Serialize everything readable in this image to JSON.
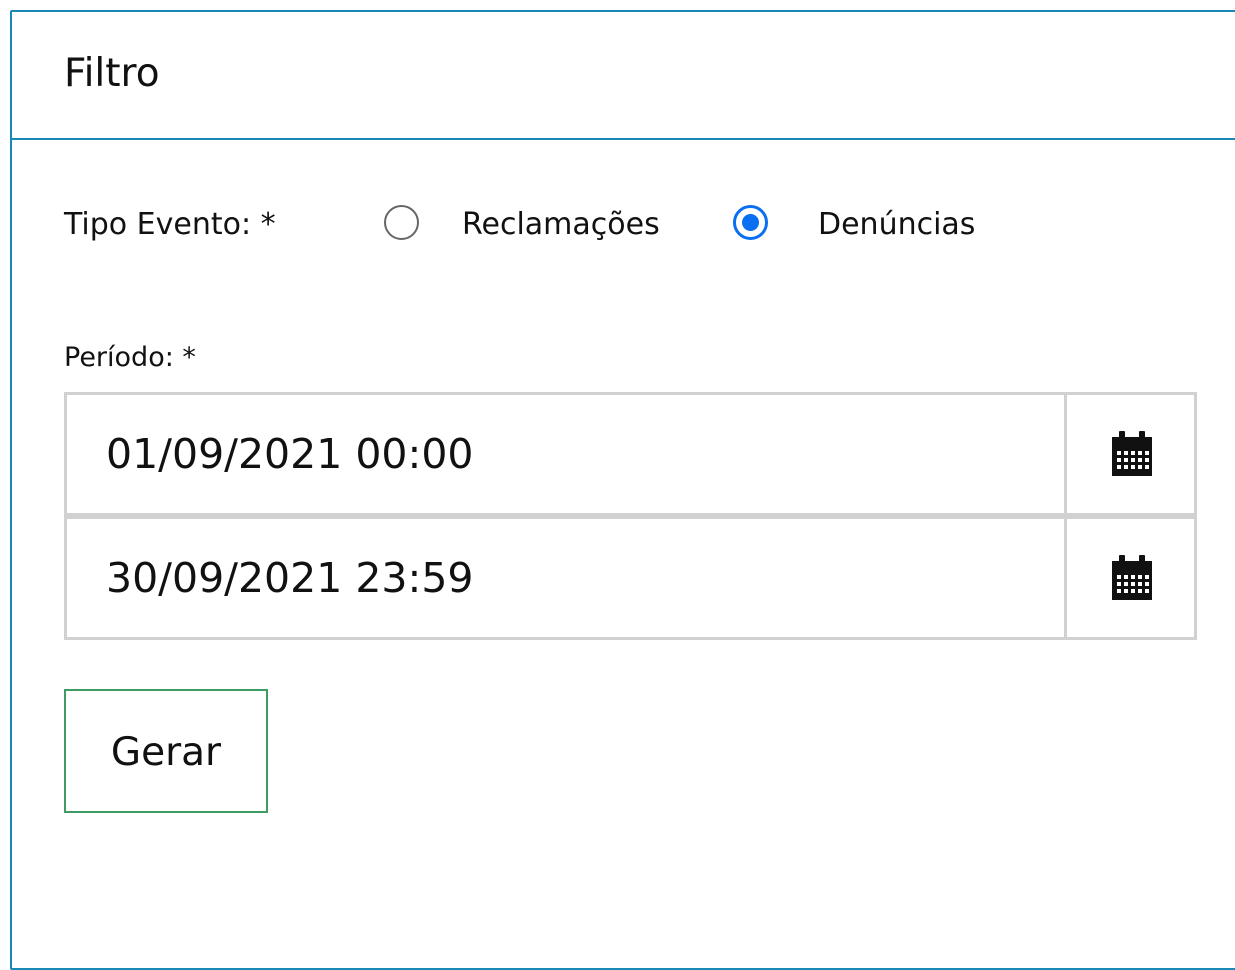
{
  "panel": {
    "title": "Filtro",
    "border_color": "#1888b5"
  },
  "tipo_evento": {
    "label": "Tipo Evento: *",
    "options": [
      {
        "label": "Reclamações",
        "checked": false
      },
      {
        "label": "Denúncias",
        "checked": true
      }
    ],
    "selected": "Denúncias",
    "accent_color": "#0a6ff0"
  },
  "periodo": {
    "label": "Período: *",
    "start_value": "01/09/2021 00:00",
    "end_value": "30/09/2021 23:59",
    "calendar_icon": "calendar-icon",
    "border_color": "#d1d1d1"
  },
  "actions": {
    "gerar_label": "Gerar",
    "button_border_color": "#3f9b63"
  }
}
